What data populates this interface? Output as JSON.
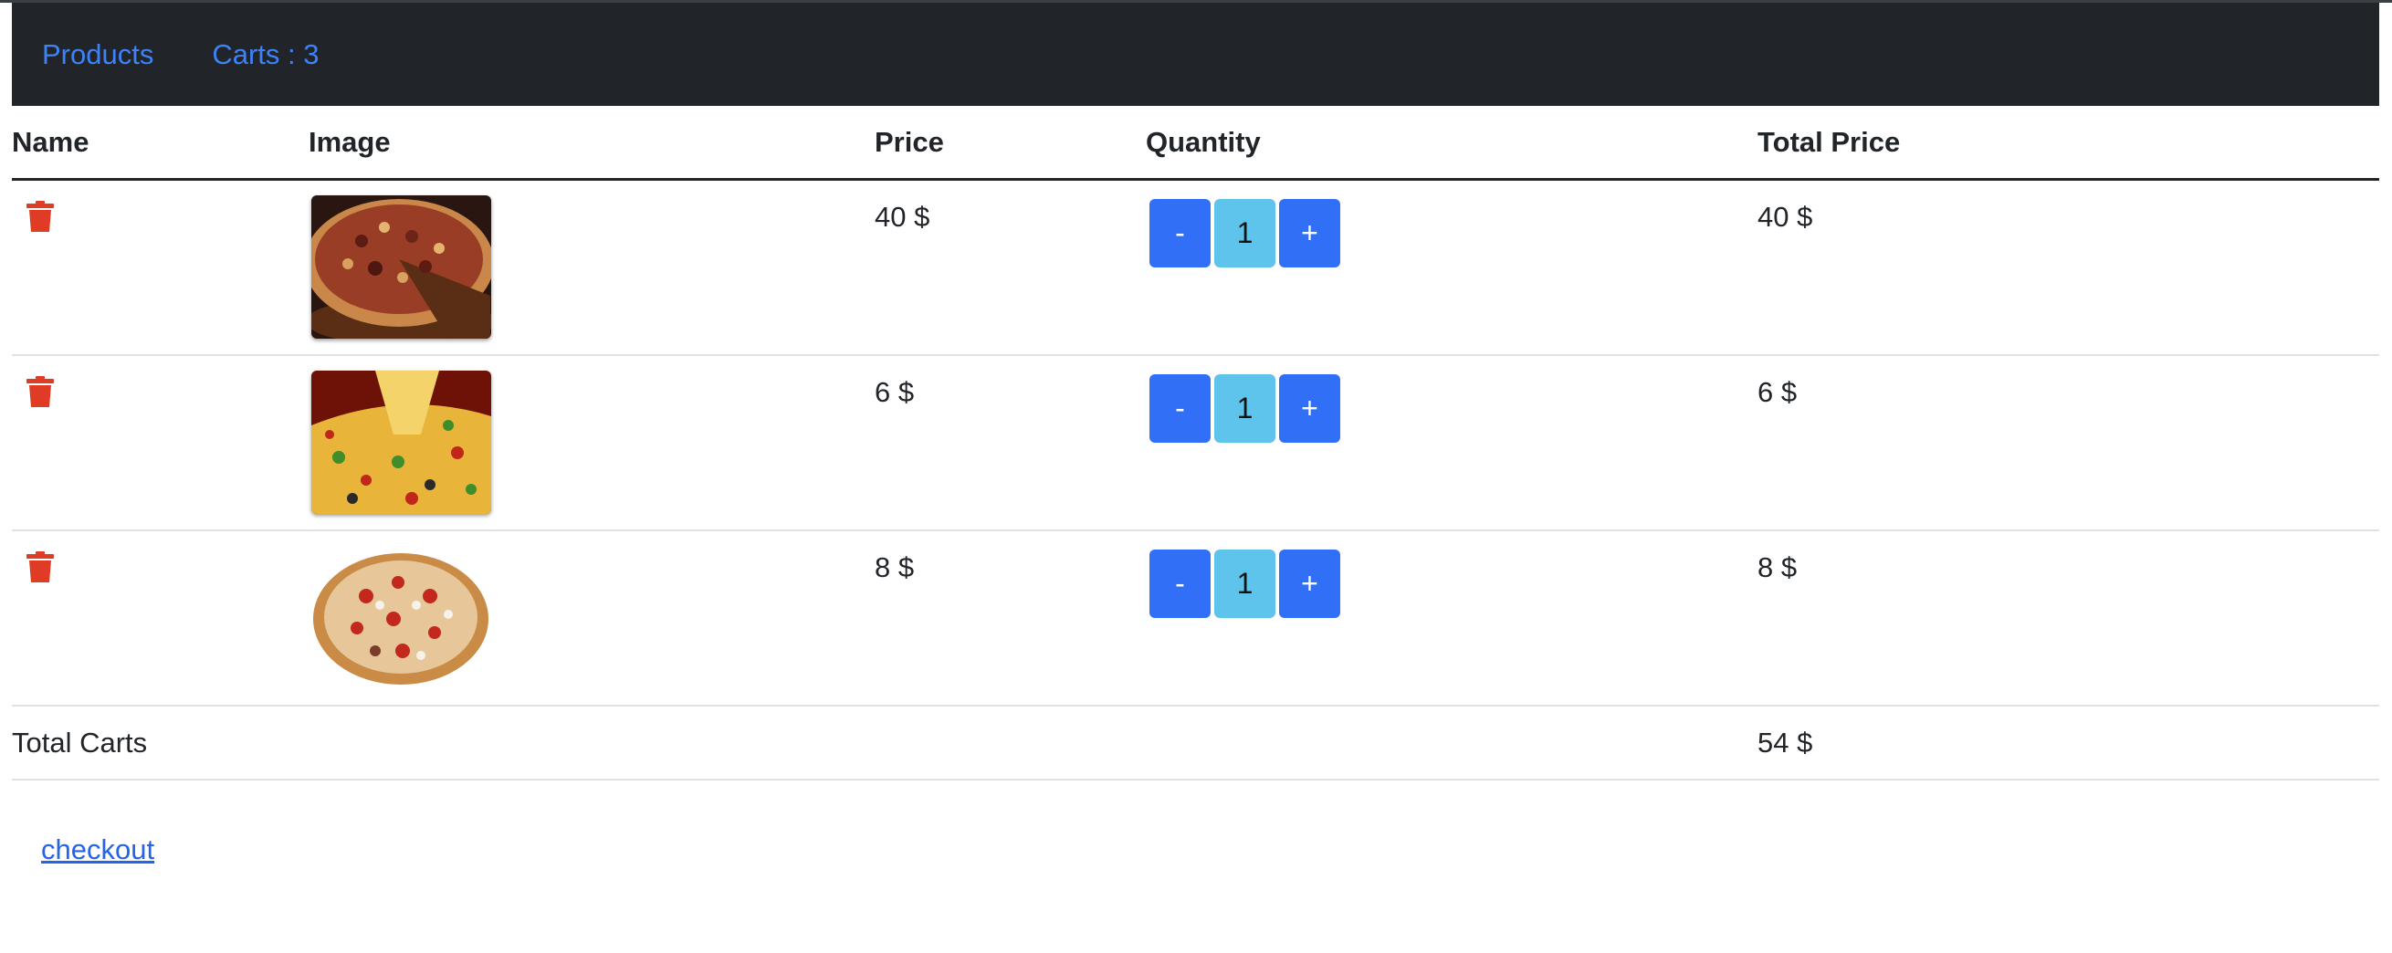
{
  "nav": {
    "products_label": "Products",
    "carts_label": "Carts : 3"
  },
  "table": {
    "headers": {
      "name": "Name",
      "image": "Image",
      "price": "Price",
      "quantity": "Quantity",
      "total_price": "Total Price"
    },
    "rows": [
      {
        "name": "",
        "image_icon": "pizza-slice-image",
        "price": "40 $",
        "quantity": "1",
        "total": "40 $"
      },
      {
        "name": "",
        "image_icon": "cheesy-pizza-image",
        "price": "6 $",
        "quantity": "1",
        "total": "6 $"
      },
      {
        "name": "",
        "image_icon": "pepperoni-pizza-image",
        "price": "8 $",
        "quantity": "1",
        "total": "8 $"
      }
    ],
    "decrement_label": "-",
    "increment_label": "+",
    "footer": {
      "label": "Total Carts",
      "total": "54 $"
    }
  },
  "checkout_label": "checkout",
  "colors": {
    "navbar": "#212529",
    "link": "#3d82f7",
    "button": "#316ff6",
    "quantity": "#5ec4ec",
    "trash": "#e03b24"
  }
}
